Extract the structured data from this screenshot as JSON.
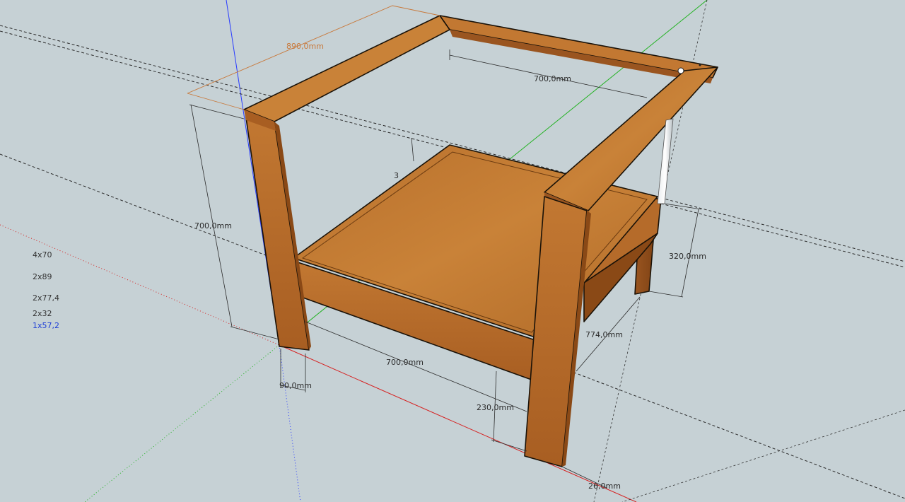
{
  "model": {
    "dimensions": {
      "top_width": "890,0mm",
      "top_depth": "700,0mm",
      "height": "700,0mm",
      "side_height": "320,0mm",
      "depth": "774,0mm",
      "front_width": "700,0mm",
      "leg_width": "90,0mm",
      "clearance": "230,0mm",
      "offset": "26,0mm",
      "partial_label": "3"
    },
    "part_list": [
      {
        "label": "4x70",
        "color": "#333333"
      },
      {
        "label": "2x89",
        "color": "#333333"
      },
      {
        "label": "2x77,4",
        "color": "#333333"
      },
      {
        "label": "2x32",
        "color": "#333333"
      },
      {
        "label": "1x57,2",
        "color": "#1f3fd6"
      }
    ]
  },
  "colors": {
    "background": "#c6d1d5",
    "axis_red": "#d62020",
    "axis_green": "#22b222",
    "axis_blue": "#2a3cff",
    "wood_light": "#c27832",
    "wood_mid": "#a85e22",
    "wood_dark": "#8a4916",
    "selected_dimension": "#c8783a"
  }
}
